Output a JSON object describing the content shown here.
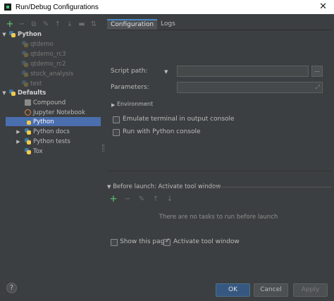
{
  "window": {
    "title": "Run/Debug Configurations",
    "close": "✕"
  },
  "toolbar": {
    "add": "+",
    "remove": "−",
    "copy": "⧉",
    "edit": "✎",
    "up": "↑",
    "down": "↓",
    "folder": "▬",
    "sort": "⇅"
  },
  "tree": {
    "python_group": "Python",
    "python_items": [
      "qtdemo",
      "qtdemo_rc3",
      "qtdemo_rc2",
      "stock_analysis",
      "test"
    ],
    "defaults_group": "Defaults",
    "defaults_items": [
      "Compound",
      "Jupyter Notebook",
      "Python",
      "Python docs",
      "Python tests",
      "Tox"
    ],
    "selected": "Python"
  },
  "tabs": [
    "Configuration",
    "Logs"
  ],
  "config": {
    "script_path_label": "Script path:",
    "script_path_value": "",
    "browse_label": "...",
    "parameters_label": "Parameters:",
    "parameters_value": "",
    "environment_label": "Environment",
    "emulate_terminal_label": "Emulate terminal in output console",
    "emulate_terminal_checked": false,
    "run_console_label": "Run with Python console",
    "run_console_checked": false
  },
  "before_launch": {
    "header": "Before launch: Activate tool window",
    "empty_text": "There are no tasks to run before launch",
    "add": "+",
    "remove": "−",
    "edit": "✎",
    "up": "↑",
    "down": "↓"
  },
  "footer": {
    "show_page_label": "Show this page",
    "show_page_checked": false,
    "activate_tool_label": "Activate tool window",
    "activate_tool_checked": true,
    "help": "?",
    "ok": "OK",
    "cancel": "Cancel",
    "apply": "Apply"
  }
}
